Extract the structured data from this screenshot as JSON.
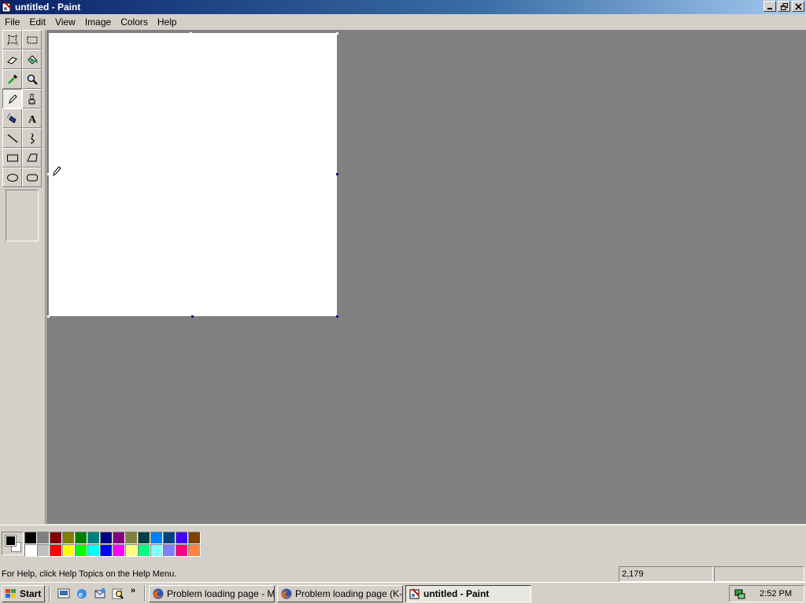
{
  "window": {
    "title": "untitled - Paint",
    "controls": {
      "minimize": "_",
      "restore": "❐",
      "close": "✕"
    }
  },
  "menu": [
    "File",
    "Edit",
    "View",
    "Image",
    "Colors",
    "Help"
  ],
  "tools": [
    {
      "name": "free-form-select-icon",
      "glyph": "⛶"
    },
    {
      "name": "select-icon",
      "glyph": "⬚"
    },
    {
      "name": "eraser-icon",
      "glyph": "▱"
    },
    {
      "name": "fill-bucket-icon",
      "glyph": "⛁"
    },
    {
      "name": "color-picker-icon",
      "glyph": "✎"
    },
    {
      "name": "magnifier-icon",
      "glyph": "🔍"
    },
    {
      "name": "pencil-icon",
      "glyph": "✏",
      "active": true
    },
    {
      "name": "brush-icon",
      "glyph": "♜"
    },
    {
      "name": "airbrush-icon",
      "glyph": "⛲"
    },
    {
      "name": "text-icon",
      "glyph": "A"
    },
    {
      "name": "line-icon",
      "glyph": "╲"
    },
    {
      "name": "curve-icon",
      "glyph": "∫"
    },
    {
      "name": "rectangle-icon",
      "glyph": "▭"
    },
    {
      "name": "polygon-icon",
      "glyph": "⏢"
    },
    {
      "name": "ellipse-icon",
      "glyph": "⬭"
    },
    {
      "name": "rounded-rectangle-icon",
      "glyph": "▢"
    }
  ],
  "palette": {
    "foreground": "#000000",
    "background": "#ffffff",
    "top": [
      "#000000",
      "#808080",
      "#800000",
      "#808000",
      "#008000",
      "#008080",
      "#000080",
      "#800080",
      "#808040",
      "#004040",
      "#0080ff",
      "#004080",
      "#4000ff",
      "#804000"
    ],
    "bottom": [
      "#ffffff",
      "#c0c0c0",
      "#ff0000",
      "#ffff00",
      "#00ff00",
      "#00ffff",
      "#0000ff",
      "#ff00ff",
      "#ffff80",
      "#00ff80",
      "#80ffff",
      "#8080ff",
      "#ff0080",
      "#ff8040"
    ]
  },
  "status": {
    "help_text": "For Help, click Help Topics on the Help Menu.",
    "coordinates": "2,179",
    "size": ""
  },
  "taskbar": {
    "start_label": "Start",
    "quick_launch": [
      "show-desktop-icon",
      "internet-explorer-icon",
      "outlook-express-icon",
      "search-icon"
    ],
    "chevron": "»",
    "tasks": [
      {
        "label": "Problem loading page - M...",
        "icon": "firefox-icon"
      },
      {
        "label": "Problem loading page (K-...",
        "icon": "firefox-icon"
      },
      {
        "label": "untitled - Paint",
        "icon": "paint-icon",
        "active": true
      }
    ],
    "clock": "2:52 PM"
  }
}
